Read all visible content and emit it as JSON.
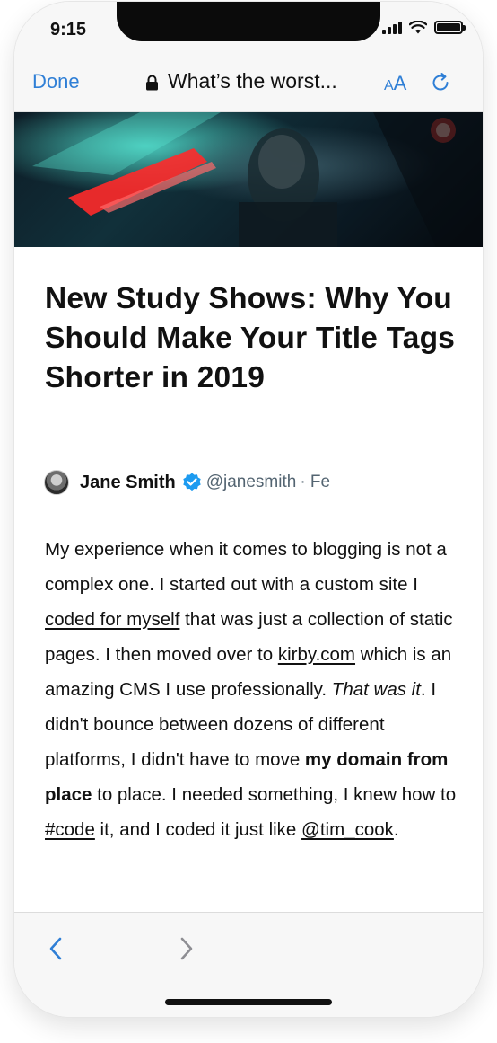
{
  "status_bar": {
    "time": "9:15",
    "icons": [
      "cellular-signal-icon",
      "wifi-icon",
      "battery-icon"
    ]
  },
  "browser_header": {
    "done_label": "Done",
    "page_title": "What’s the worst...",
    "text_size_small": "A",
    "text_size_large": "A",
    "icons": [
      "lock-icon",
      "text-size-icon",
      "reload-icon"
    ]
  },
  "article": {
    "headline": "New Study Shows: Why You Should Make Your Title Tags Shorter in 2019",
    "author": {
      "name": "Jane Smith",
      "handle": "@janesmith",
      "date_fragment": "· Fe"
    },
    "body": {
      "p1": "My experience when it comes to blogging is not a complex one. I started out with a custom site I ",
      "link1": "coded for myself",
      "p2": " that was just a collection of static pages. I then moved over to ",
      "link2": "kirby.com",
      "p3": " which is an amazing CMS I use professionally. ",
      "em1": "That was it",
      "p4": ". I didn't bounce between dozens of different platforms, I didn't have to move ",
      "strong1": "my domain from place",
      "p5": " to place. I needed something, I knew how to ",
      "hashtag": "#code",
      "p6": " it, and I coded it just like ",
      "mention": "@tim_cook",
      "p7": "."
    }
  },
  "colors": {
    "accent": "#2f7fd6",
    "verified_badge": "#1d9bf0",
    "secondary_text": "#536471",
    "toolbar_bg": "#f7f7f7"
  },
  "toolbar": {
    "icons": [
      "chevron-left-icon",
      "chevron-right-icon"
    ]
  }
}
